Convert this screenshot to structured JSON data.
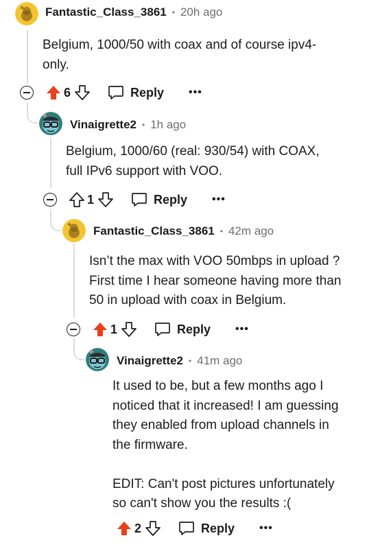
{
  "comments": [
    {
      "username": "Fantastic_Class_3861",
      "separator": "•",
      "time": "20h ago",
      "body": [
        "Belgium, 1000/50 with coax and of course ipv4-",
        "only."
      ],
      "votes": "6",
      "upvoted": true,
      "reply_label": "Reply",
      "more_label": "•••"
    },
    {
      "username": "Vinaigrette2",
      "separator": "•",
      "time": "1h ago",
      "body": [
        "Belgium, 1000/60 (real: 930/54) with COAX,",
        "full IPv6 support with VOO."
      ],
      "votes": "1",
      "upvoted": false,
      "reply_label": "Reply",
      "more_label": "•••"
    },
    {
      "username": "Fantastic_Class_3861",
      "separator": "•",
      "time": "42m ago",
      "body": [
        "Isn’t the max with VOO 50mbps in upload ?",
        "First time I hear someone having more than",
        "50 in upload with coax in Belgium."
      ],
      "votes": "1",
      "upvoted": true,
      "reply_label": "Reply",
      "more_label": "•••"
    },
    {
      "username": "Vinaigrette2",
      "separator": "•",
      "time": "41m ago",
      "body": [
        "It used to be, but a few months ago I",
        "noticed that it increased! I am guessing",
        "they enabled from upload channels in",
        "the firmware.",
        "",
        "EDIT: Can't post pictures unfortunately",
        "so can't show you the results :("
      ],
      "votes": "2",
      "upvoted": true,
      "reply_label": "Reply",
      "more_label": "•••"
    }
  ],
  "colors": {
    "upvote": "#e8401c",
    "thread_line": "#dcdcdc",
    "avatar_yellow": "#f4c430"
  },
  "icons": [
    "avatar-snoo-icon",
    "avatar-glasses-icon",
    "collapse-icon",
    "upvote-arrow-icon",
    "downvote-arrow-icon",
    "reply-bubble-icon",
    "more-icon"
  ]
}
